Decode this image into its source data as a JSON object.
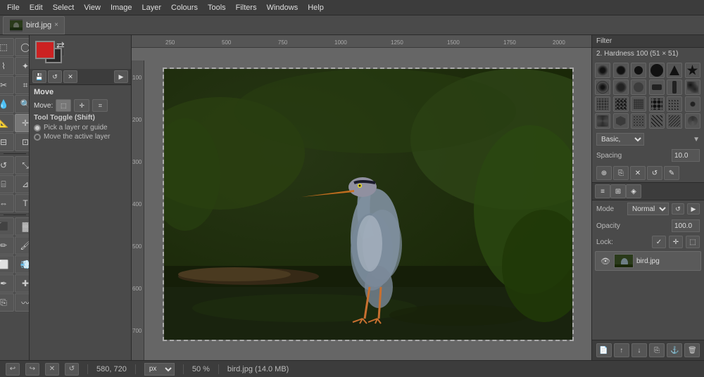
{
  "menubar": {
    "items": [
      "File",
      "Edit",
      "Select",
      "View",
      "Image",
      "Layer",
      "Colours",
      "Tools",
      "Filters",
      "Windows",
      "Help"
    ]
  },
  "tab": {
    "label": "bird.jpg",
    "close": "×"
  },
  "toolbox": {
    "tools": [
      {
        "name": "rect-select",
        "icon": "⬚"
      },
      {
        "name": "ellipse-select",
        "icon": "◯"
      },
      {
        "name": "free-select",
        "icon": "⌇"
      },
      {
        "name": "fuzzy-select",
        "icon": "✦"
      },
      {
        "name": "scissors",
        "icon": "✂"
      },
      {
        "name": "paths",
        "icon": "⌗"
      },
      {
        "name": "color-picker",
        "icon": "💧"
      },
      {
        "name": "zoom",
        "icon": "🔍"
      },
      {
        "name": "measure",
        "icon": "📏"
      },
      {
        "name": "move",
        "icon": "✛"
      },
      {
        "name": "align",
        "icon": "⊟"
      },
      {
        "name": "crop",
        "icon": "⊡"
      },
      {
        "name": "rotate",
        "icon": "↺"
      },
      {
        "name": "scale",
        "icon": "⤡"
      },
      {
        "name": "shear",
        "icon": "⌸"
      },
      {
        "name": "perspective",
        "icon": "⊿"
      },
      {
        "name": "flip",
        "icon": "⇔"
      },
      {
        "name": "text",
        "icon": "T"
      },
      {
        "name": "bucket-fill",
        "icon": "⬛"
      },
      {
        "name": "blend",
        "icon": "▓"
      },
      {
        "name": "pencil",
        "icon": "✏"
      },
      {
        "name": "paintbrush",
        "icon": "🖌"
      },
      {
        "name": "eraser",
        "icon": "⬜"
      },
      {
        "name": "airbrush",
        "icon": "💨"
      },
      {
        "name": "ink",
        "icon": "✒"
      },
      {
        "name": "heal",
        "icon": "✚"
      },
      {
        "name": "clone",
        "icon": "⎘"
      },
      {
        "name": "smudge",
        "icon": "〰"
      },
      {
        "name": "dodge-burn",
        "icon": "◑"
      }
    ]
  },
  "left_panel": {
    "move_label": "Move",
    "move_sublabel": "Move:",
    "tool_toggle_label": "Tool Toggle (Shift)",
    "option1": "Pick a layer or guide",
    "option2": "Move the active layer"
  },
  "canvas": {
    "filename": "bird.jpg",
    "zoom": "50 %",
    "size_info": "bird.jpg (14.0 MB)",
    "coords": "580, 720",
    "unit": "px"
  },
  "right_panel": {
    "filter_label": "Filter",
    "brush_label": "2. Hardness 100 (51 × 51)",
    "brush_section_label": "Basic,",
    "spacing_label": "Spacing",
    "spacing_value": "10.0",
    "layers_mode_label": "Mode",
    "layers_mode_value": "Normal",
    "opacity_label": "Opacity",
    "opacity_value": "100.0",
    "lock_label": "Lock:",
    "layer_name": "bird.jpg"
  },
  "statusbar": {
    "coords": "580, 720",
    "unit": "px",
    "zoom": "50 %",
    "fileinfo": "bird.jpg (14.0 MB)",
    "undo_icon": "↩",
    "redo_icon": "↪",
    "cancel_icon": "✕",
    "restore_icon": "↺"
  }
}
